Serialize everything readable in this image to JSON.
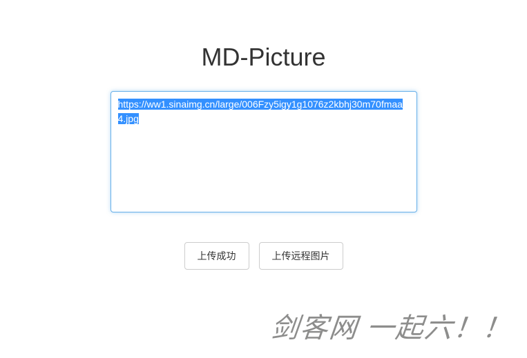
{
  "title": "MD-Picture",
  "textarea": {
    "value": "https://ww1.sinaimg.cn/large/006Fzy5igy1g1076z2kbhj30m70fmaa4.jpg",
    "selected": true
  },
  "buttons": {
    "status": "上传成功",
    "remote": "上传远程图片"
  },
  "watermark": "剑客网 一起六！！"
}
